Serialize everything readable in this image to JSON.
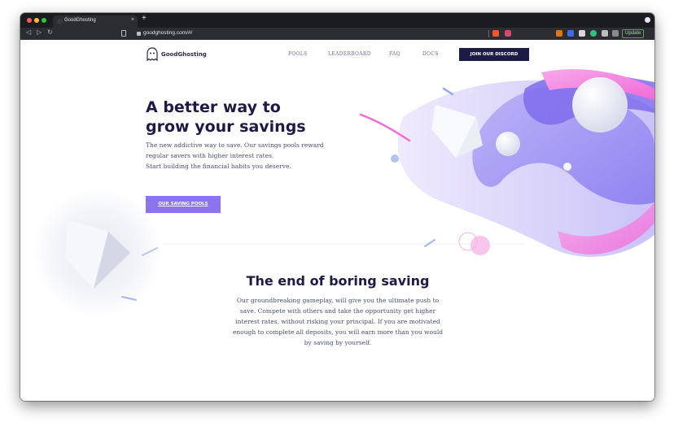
{
  "browser": {
    "tab_title": "GoodGhosting",
    "tab_close": "×",
    "new_tab": "+",
    "url": "goodghosting.com/#/",
    "update_label": "Update"
  },
  "site": {
    "logo_text": "GoodGhosting",
    "nav": [
      "POOLS",
      "LEADERBOARD",
      "FAQ",
      "DOCS"
    ],
    "cta": "JOIN OUR DISCORD"
  },
  "hero": {
    "title_line1": "A better way to",
    "title_line2": "grow your savings",
    "desc": [
      "The new addictive way to save. Our savings pools reward",
      "regular savers with higher interest rates.",
      "Start building the financial habits you deserve."
    ],
    "button": "OUR SAVING POOLS"
  },
  "section": {
    "title": "The end of boring saving",
    "desc": "Our groundbreaking gameplay, will give you the ultimate push to save. Compete with others and take the opportunity get higher interest rates, without risking your principal. If you are motivated enough to complete all deposits, you will earn more than you would by saving by yourself."
  },
  "icons": [
    "back-icon",
    "forward-icon",
    "reload-icon",
    "bookmark-icon",
    "lock-icon",
    "brave-shield-icon",
    "extension-icons",
    "ghost-logo-icon"
  ],
  "colors": {
    "accent": "#8c74ee",
    "navy": "#1d1b45",
    "pink": "#f06ad8"
  }
}
